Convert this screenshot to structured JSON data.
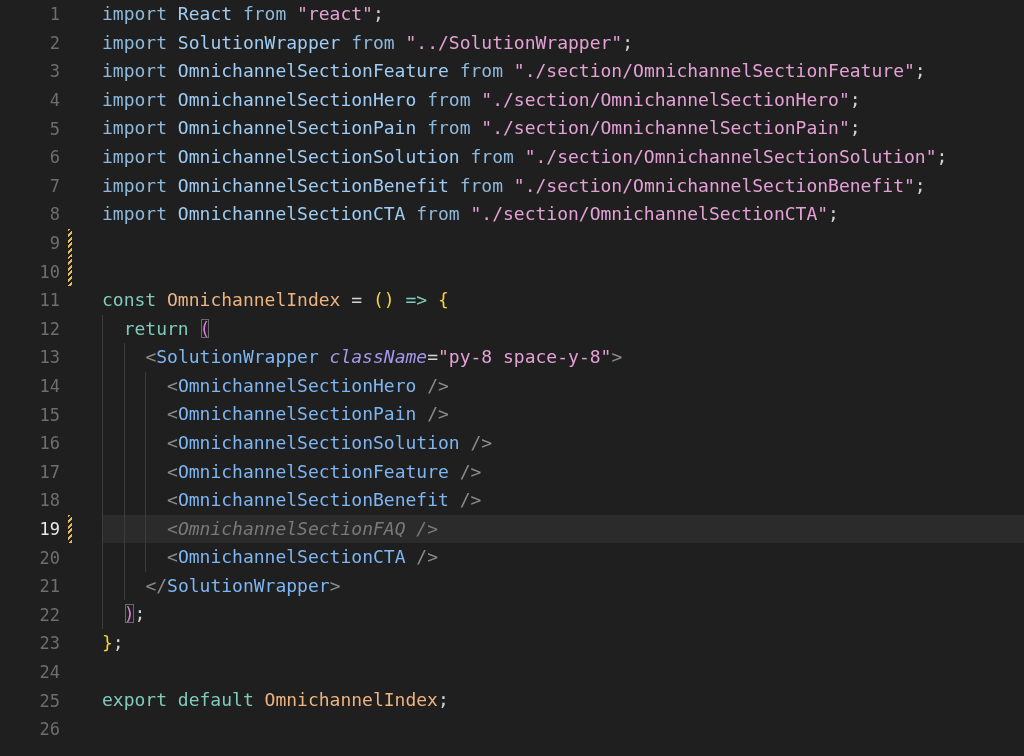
{
  "editor": {
    "lines": [
      {
        "number": "1",
        "modified": false,
        "current": false,
        "tokens": [
          {
            "kind": "kw",
            "text": "import"
          },
          {
            "kind": "var",
            "text": " React "
          },
          {
            "kind": "kw",
            "text": "from"
          },
          {
            "kind": "str",
            "text": " \"react\""
          },
          {
            "kind": "punct",
            "text": ";"
          }
        ]
      },
      {
        "number": "2",
        "modified": false,
        "current": false,
        "tokens": [
          {
            "kind": "kw",
            "text": "import"
          },
          {
            "kind": "var",
            "text": " SolutionWrapper "
          },
          {
            "kind": "kw",
            "text": "from"
          },
          {
            "kind": "str",
            "text": " \"../SolutionWrapper\""
          },
          {
            "kind": "punct",
            "text": ";"
          }
        ]
      },
      {
        "number": "3",
        "modified": false,
        "current": false,
        "tokens": [
          {
            "kind": "kw",
            "text": "import"
          },
          {
            "kind": "var",
            "text": " OmnichannelSectionFeature "
          },
          {
            "kind": "kw",
            "text": "from"
          },
          {
            "kind": "str",
            "text": " \"./section/OmnichannelSectionFeature\""
          },
          {
            "kind": "punct",
            "text": ";"
          }
        ]
      },
      {
        "number": "4",
        "modified": false,
        "current": false,
        "tokens": [
          {
            "kind": "kw",
            "text": "import"
          },
          {
            "kind": "var",
            "text": " OmnichannelSectionHero "
          },
          {
            "kind": "kw",
            "text": "from"
          },
          {
            "kind": "str",
            "text": " \"./section/OmnichannelSectionHero\""
          },
          {
            "kind": "punct",
            "text": ";"
          }
        ]
      },
      {
        "number": "5",
        "modified": false,
        "current": false,
        "tokens": [
          {
            "kind": "kw",
            "text": "import"
          },
          {
            "kind": "var",
            "text": " OmnichannelSectionPain "
          },
          {
            "kind": "kw",
            "text": "from"
          },
          {
            "kind": "str",
            "text": " \"./section/OmnichannelSectionPain\""
          },
          {
            "kind": "punct",
            "text": ";"
          }
        ]
      },
      {
        "number": "6",
        "modified": false,
        "current": false,
        "tokens": [
          {
            "kind": "kw",
            "text": "import"
          },
          {
            "kind": "var",
            "text": " OmnichannelSectionSolution "
          },
          {
            "kind": "kw",
            "text": "from"
          },
          {
            "kind": "str",
            "text": " \"./section/OmnichannelSectionSolution\""
          },
          {
            "kind": "punct",
            "text": ";"
          }
        ]
      },
      {
        "number": "7",
        "modified": false,
        "current": false,
        "tokens": [
          {
            "kind": "kw",
            "text": "import"
          },
          {
            "kind": "var",
            "text": " OmnichannelSectionBenefit "
          },
          {
            "kind": "kw",
            "text": "from"
          },
          {
            "kind": "str",
            "text": " \"./section/OmnichannelSectionBenefit\""
          },
          {
            "kind": "punct",
            "text": ";"
          }
        ]
      },
      {
        "number": "8",
        "modified": false,
        "current": false,
        "tokens": [
          {
            "kind": "kw",
            "text": "import"
          },
          {
            "kind": "var",
            "text": " OmnichannelSectionCTA "
          },
          {
            "kind": "kw",
            "text": "from"
          },
          {
            "kind": "str",
            "text": " \"./section/OmnichannelSectionCTA\""
          },
          {
            "kind": "punct",
            "text": ";"
          }
        ]
      },
      {
        "number": "9",
        "modified": true,
        "current": false
      },
      {
        "number": "10",
        "modified": true,
        "current": false
      },
      {
        "number": "11",
        "modified": false,
        "current": false,
        "tokens": [
          {
            "kind": "decl",
            "text": "const "
          },
          {
            "kind": "fn",
            "text": "OmnichannelIndex"
          },
          {
            "kind": "punct",
            "text": " = "
          },
          {
            "kind": "brace",
            "text": "()"
          },
          {
            "kind": "decl",
            "text": " => "
          },
          {
            "kind": "brace",
            "text": "{"
          }
        ]
      },
      {
        "number": "12",
        "modified": false,
        "current": false,
        "tokens": [
          {
            "kind": "decl",
            "text": "  return "
          },
          {
            "kind": "paren-match",
            "text": "("
          }
        ]
      },
      {
        "number": "13",
        "modified": false,
        "current": false,
        "tokens": [
          {
            "kind": "tagpunct",
            "text": "    <"
          },
          {
            "kind": "tag",
            "text": "SolutionWrapper "
          },
          {
            "kind": "attr",
            "text": "className"
          },
          {
            "kind": "punct",
            "text": "="
          },
          {
            "kind": "str",
            "text": "\"py-8 space-y-8\""
          },
          {
            "kind": "tagpunct",
            "text": ">"
          }
        ]
      },
      {
        "number": "14",
        "modified": false,
        "current": false,
        "tokens": [
          {
            "kind": "tagpunct",
            "text": "      <"
          },
          {
            "kind": "tag",
            "text": "OmnichannelSectionHero "
          },
          {
            "kind": "tagpunct",
            "text": "/>"
          }
        ]
      },
      {
        "number": "15",
        "modified": false,
        "current": false,
        "tokens": [
          {
            "kind": "tagpunct",
            "text": "      <"
          },
          {
            "kind": "tag",
            "text": "OmnichannelSectionPain "
          },
          {
            "kind": "tagpunct",
            "text": "/>"
          }
        ]
      },
      {
        "number": "16",
        "modified": false,
        "current": false,
        "tokens": [
          {
            "kind": "tagpunct",
            "text": "      <"
          },
          {
            "kind": "tag",
            "text": "OmnichannelSectionSolution "
          },
          {
            "kind": "tagpunct",
            "text": "/>"
          }
        ]
      },
      {
        "number": "17",
        "modified": false,
        "current": false,
        "tokens": [
          {
            "kind": "tagpunct",
            "text": "      <"
          },
          {
            "kind": "tag",
            "text": "OmnichannelSectionFeature "
          },
          {
            "kind": "tagpunct",
            "text": "/>"
          }
        ]
      },
      {
        "number": "18",
        "modified": false,
        "current": false,
        "tokens": [
          {
            "kind": "tagpunct",
            "text": "      <"
          },
          {
            "kind": "tag",
            "text": "OmnichannelSectionBenefit "
          },
          {
            "kind": "tagpunct",
            "text": "/>"
          }
        ]
      },
      {
        "number": "19",
        "modified": true,
        "current": true,
        "tokens": [
          {
            "kind": "comment",
            "text": "      <OmnichannelSectionFAQ />"
          }
        ]
      },
      {
        "number": "20",
        "modified": false,
        "current": false,
        "tokens": [
          {
            "kind": "tagpunct",
            "text": "      <"
          },
          {
            "kind": "tag",
            "text": "OmnichannelSectionCTA "
          },
          {
            "kind": "tagpunct",
            "text": "/>"
          }
        ]
      },
      {
        "number": "21",
        "modified": false,
        "current": false,
        "tokens": [
          {
            "kind": "tagpunct",
            "text": "    </"
          },
          {
            "kind": "tag",
            "text": "SolutionWrapper"
          },
          {
            "kind": "tagpunct",
            "text": ">"
          }
        ]
      },
      {
        "number": "22",
        "modified": false,
        "current": false,
        "tokens": [
          {
            "kind": "paren-match",
            "text": "  )"
          },
          {
            "kind": "punct",
            "text": ";"
          }
        ]
      },
      {
        "number": "23",
        "modified": false,
        "current": false,
        "tokens": [
          {
            "kind": "brace",
            "text": "}"
          },
          {
            "kind": "punct",
            "text": ";"
          }
        ]
      },
      {
        "number": "24",
        "modified": false,
        "current": false
      },
      {
        "number": "25",
        "modified": false,
        "current": false,
        "tokens": [
          {
            "kind": "decl",
            "text": "export default "
          },
          {
            "kind": "fn",
            "text": "OmnichannelIndex"
          },
          {
            "kind": "punct",
            "text": ";"
          }
        ]
      },
      {
        "number": "26",
        "modified": false,
        "current": false
      }
    ]
  }
}
